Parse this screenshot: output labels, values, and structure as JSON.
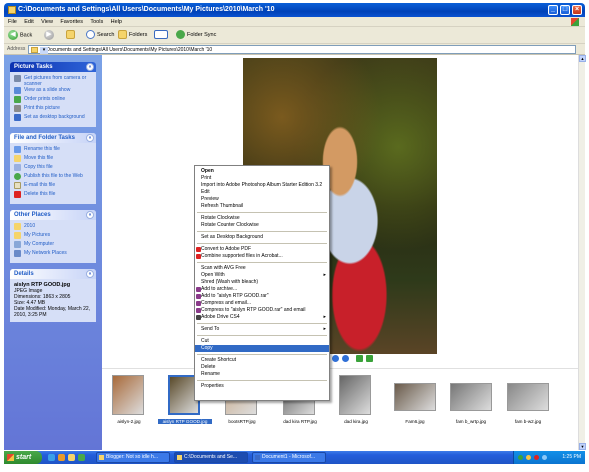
{
  "window": {
    "title": "C:\\Documents and Settings\\All Users\\Documents\\My Pictures\\2010\\March '10",
    "controls": {
      "minimize": "_",
      "maximize": "□",
      "close": "×"
    }
  },
  "menu": [
    "File",
    "Edit",
    "View",
    "Favorites",
    "Tools",
    "Help"
  ],
  "toolbar": {
    "back_label": "Back",
    "back_arrow": "◀",
    "forward_arrow": "▶",
    "search_label": "Search",
    "folders_label": "Folders",
    "folder_sync_label": "Folder Sync"
  },
  "address": {
    "label": "Address",
    "value": "C:\\Documents and Settings\\All Users\\Documents\\My Pictures\\2010\\March '10",
    "go_arrow": "▾"
  },
  "sidebar": {
    "picture_tasks": {
      "title": "Picture Tasks",
      "items": [
        "Get pictures from camera or scanner",
        "View as a slide show",
        "Order prints online",
        "Print this picture",
        "Set as desktop background"
      ]
    },
    "file_folder_tasks": {
      "title": "File and Folder Tasks",
      "items": [
        "Rename this file",
        "Move this file",
        "Copy this file",
        "Publish this file to the Web",
        "E-mail this file",
        "Delete this file"
      ]
    },
    "other_places": {
      "title": "Other Places",
      "items": [
        "2010",
        "My Pictures",
        "My Computer",
        "My Network Places"
      ]
    },
    "details": {
      "title": "Details",
      "filename": "aislyn RTP GOOD.jpg",
      "type": "JPEG Image",
      "dimensions": "Dimensions: 1863 x 2805",
      "size": "Size: 4.47 MB",
      "date_modified": "Date Modified: Monday, March 22, 2010, 3:25 PM"
    },
    "chevron": "«"
  },
  "context_menu": {
    "items": [
      {
        "label": "Open",
        "bold": true
      },
      {
        "label": "Print"
      },
      {
        "label": "Import into Adobe Photoshop Album Starter Edition 3.2"
      },
      {
        "label": "Edit"
      },
      {
        "label": "Preview"
      },
      {
        "label": "Refresh Thumbnail"
      },
      {
        "sep": true
      },
      {
        "label": "Rotate Clockwise"
      },
      {
        "label": "Rotate Counter Clockwise"
      },
      {
        "sep": true
      },
      {
        "label": "Set as Desktop Background"
      },
      {
        "sep": true
      },
      {
        "label": "Convert to Adobe PDF",
        "icon": "#d22"
      },
      {
        "label": "Combine supported files in Acrobat...",
        "icon": "#d22"
      },
      {
        "sep": true
      },
      {
        "label": "Scan with AVG Free"
      },
      {
        "label": "Open With",
        "submenu": true
      },
      {
        "label": "Shred (Wash with bleach)"
      },
      {
        "label": "Add to archive...",
        "icon": "#8a3a8a"
      },
      {
        "label": "Add to \"aislyn RTP GOOD.rar\"",
        "icon": "#8a3a8a"
      },
      {
        "label": "Compress and email...",
        "icon": "#8a3a8a"
      },
      {
        "label": "Compress to \"aislyn RTP GOOD.rar\" and email",
        "icon": "#8a3a8a"
      },
      {
        "label": "Adobe Drive CS4",
        "submenu": true,
        "icon": "#444"
      },
      {
        "sep": true
      },
      {
        "label": "Send To",
        "submenu": true
      },
      {
        "sep": true
      },
      {
        "label": "Cut"
      },
      {
        "label": "Copy",
        "highlight": true
      },
      {
        "sep": true
      },
      {
        "label": "Create Shortcut"
      },
      {
        "label": "Delete"
      },
      {
        "label": "Rename"
      },
      {
        "sep": true
      },
      {
        "label": "Properties"
      }
    ],
    "submenu_arrow": "▸"
  },
  "thumbnails": [
    {
      "label": "aislyn-2.jpg",
      "wide": false,
      "color": "#a86a3a"
    },
    {
      "label": "aislyn RTP GOOD.jpg",
      "wide": false,
      "color": "#5a4a2a",
      "selected": true
    },
    {
      "label": "bootsRTP.jpg",
      "wide": false,
      "color": "#c8a888"
    },
    {
      "label": "dad kira RTP.jpg",
      "wide": false,
      "color": "#555"
    },
    {
      "label": "dad kira.jpg",
      "wide": false,
      "color": "#666"
    },
    {
      "label": "Fam6.jpg",
      "wide": true,
      "color": "#6a5a4a"
    },
    {
      "label": "fam b_wrtp.jpg",
      "wide": true,
      "color": "#777"
    },
    {
      "label": "fam b-w2.jpg",
      "wide": true,
      "color": "#888"
    }
  ],
  "taskbar": {
    "start_label": "start",
    "buttons": [
      "Blogger: Not so idle h...",
      "C:\\Documents and Se...",
      "Document1 - Microsof..."
    ],
    "clock": "1:25 PM"
  }
}
